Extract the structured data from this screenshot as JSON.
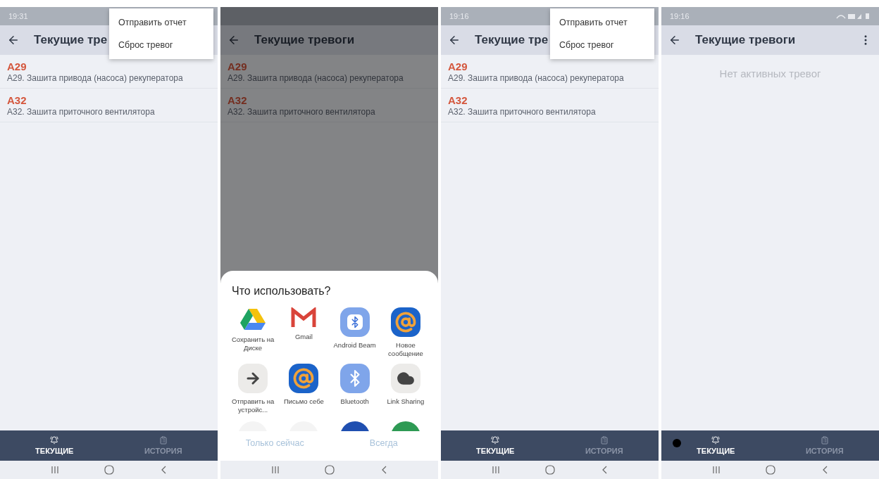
{
  "screens": [
    {
      "status_time": "19:31",
      "title": "Текущие тре",
      "more_button": false,
      "dimmed": false,
      "touch_indicator": false,
      "alarms": [
        {
          "code": "A29",
          "text": "A29. Зашита привода (насоса) рекуператора"
        },
        {
          "code": "A32",
          "text": "A32. Зашита приточного вентилятора"
        }
      ],
      "popup_menu": [
        "Отправить отчет",
        "Сброс тревог"
      ],
      "tabs": [
        {
          "label": "ТЕКУЩИЕ",
          "selected": true
        },
        {
          "label": "ИСТОРИЯ",
          "selected": false
        }
      ]
    },
    {
      "title": "Текущие тревоги",
      "more_button": false,
      "dimmed": true,
      "touch_indicator": false,
      "alarms": [
        {
          "code": "A29",
          "text": "A29. Зашита привода (насоса) рекуператора"
        },
        {
          "code": "A32",
          "text": "A32. Зашита приточного вентилятора"
        }
      ],
      "share_sheet": {
        "title": "Что использовать?",
        "apps": [
          {
            "kind": "drive",
            "label": "Сохранить на Диске"
          },
          {
            "kind": "gmail",
            "label": "Gmail"
          },
          {
            "kind": "beam",
            "label": "Android Beam"
          },
          {
            "kind": "mail",
            "label": "Новое сообщение"
          },
          {
            "kind": "transfer",
            "label": "Отправить на устройс..."
          },
          {
            "kind": "mail",
            "label": "Письмо себе"
          },
          {
            "kind": "bluetooth",
            "label": "Bluetooth"
          },
          {
            "kind": "cloud",
            "label": "Link Sharing"
          }
        ],
        "buttons": [
          "Только сейчас",
          "Всегда"
        ]
      }
    },
    {
      "status_time": "19:16",
      "title": "Текущие тре",
      "more_button": false,
      "dimmed": false,
      "touch_indicator": false,
      "alarms": [
        {
          "code": "A29",
          "text": "A29. Зашита привода (насоса) рекуператора"
        },
        {
          "code": "A32",
          "text": "A32. Зашита приточного вентилятора"
        }
      ],
      "popup_menu": [
        "Отправить отчет",
        "Сброс тревог"
      ],
      "tabs": [
        {
          "label": "ТЕКУЩИЕ",
          "selected": true
        },
        {
          "label": "ИСТОРИЯ",
          "selected": false
        }
      ]
    },
    {
      "status_time": "19:16",
      "title": "Текущие тревоги",
      "more_button": true,
      "dimmed": false,
      "touch_indicator": true,
      "empty_text": "Нет активных тревог",
      "tabs": [
        {
          "label": "ТЕКУЩИЕ",
          "selected": true
        },
        {
          "label": "ИСТОРИЯ",
          "selected": false
        }
      ]
    }
  ]
}
